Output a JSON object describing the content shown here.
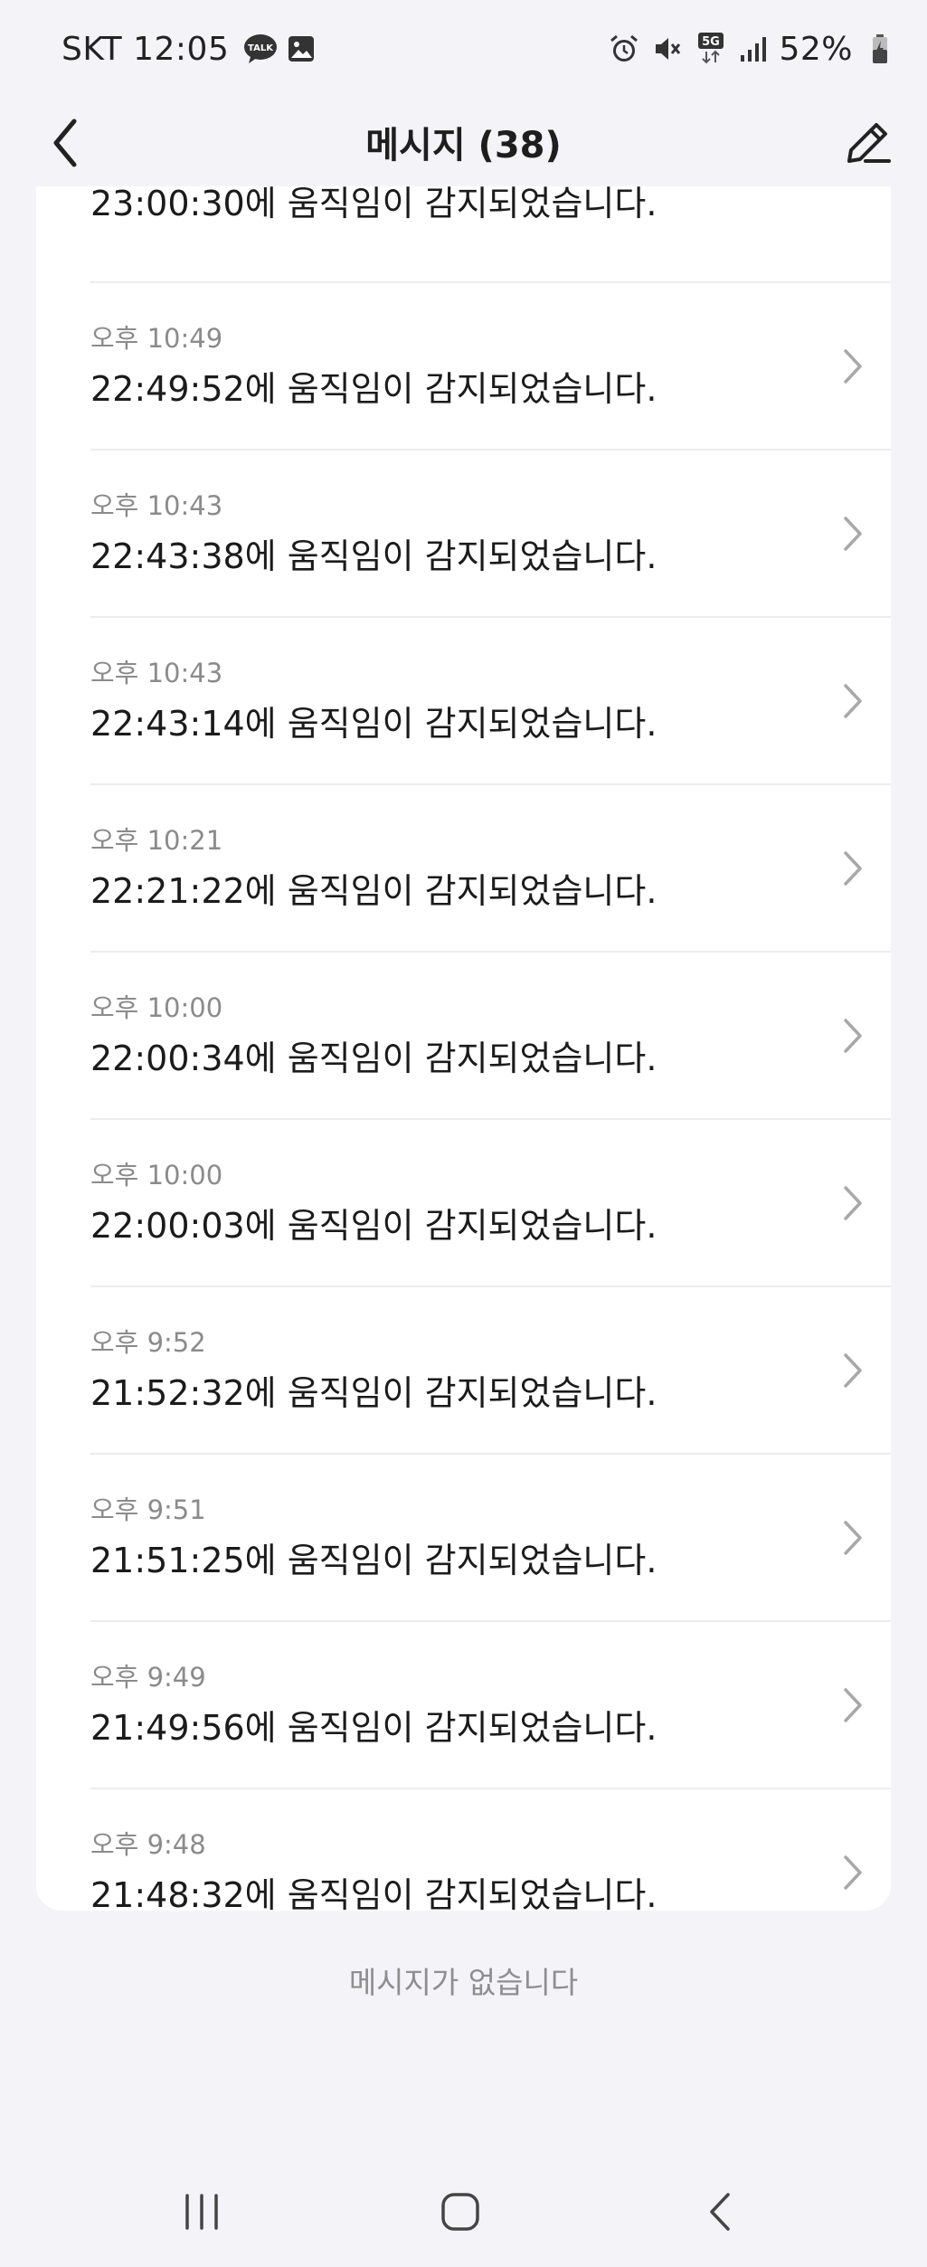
{
  "status_bar": {
    "carrier_time": "SKT 12:05",
    "battery": "52%",
    "network": "5G",
    "icons": [
      "talk-icon",
      "gallery-icon",
      "alarm-icon",
      "mute-icon",
      "5g-icon",
      "signal-icon",
      "battery-icon"
    ]
  },
  "header": {
    "title": "메시지 (38)",
    "back_icon": "chevron-left-icon",
    "compose_icon": "pencil-icon"
  },
  "messages": [
    {
      "time": "",
      "text": "23:00:30에 움직임이 감지되었습니다."
    },
    {
      "time": "오후 10:49",
      "text": "22:49:52에 움직임이 감지되었습니다."
    },
    {
      "time": "오후 10:43",
      "text": "22:43:38에 움직임이 감지되었습니다."
    },
    {
      "time": "오후 10:43",
      "text": "22:43:14에 움직임이 감지되었습니다."
    },
    {
      "time": "오후 10:21",
      "text": "22:21:22에 움직임이 감지되었습니다."
    },
    {
      "time": "오후 10:00",
      "text": "22:00:34에 움직임이 감지되었습니다."
    },
    {
      "time": "오후 10:00",
      "text": "22:00:03에 움직임이 감지되었습니다."
    },
    {
      "time": "오후 9:52",
      "text": "21:52:32에 움직임이 감지되었습니다."
    },
    {
      "time": "오후 9:51",
      "text": "21:51:25에 움직임이 감지되었습니다."
    },
    {
      "time": "오후 9:49",
      "text": "21:49:56에 움직임이 감지되었습니다."
    },
    {
      "time": "오후 9:48",
      "text": "21:48:32에 움직임이 감지되었습니다."
    }
  ],
  "empty_note": "메시지가 없습니다",
  "nav_bar": {
    "recent_icon": "recent-apps-icon",
    "home_icon": "home-icon",
    "back_icon": "back-icon"
  },
  "colors": {
    "background": "#f4f4f8",
    "card": "#ffffff",
    "time_text": "#8b8b8b",
    "divider": "#ececec"
  }
}
